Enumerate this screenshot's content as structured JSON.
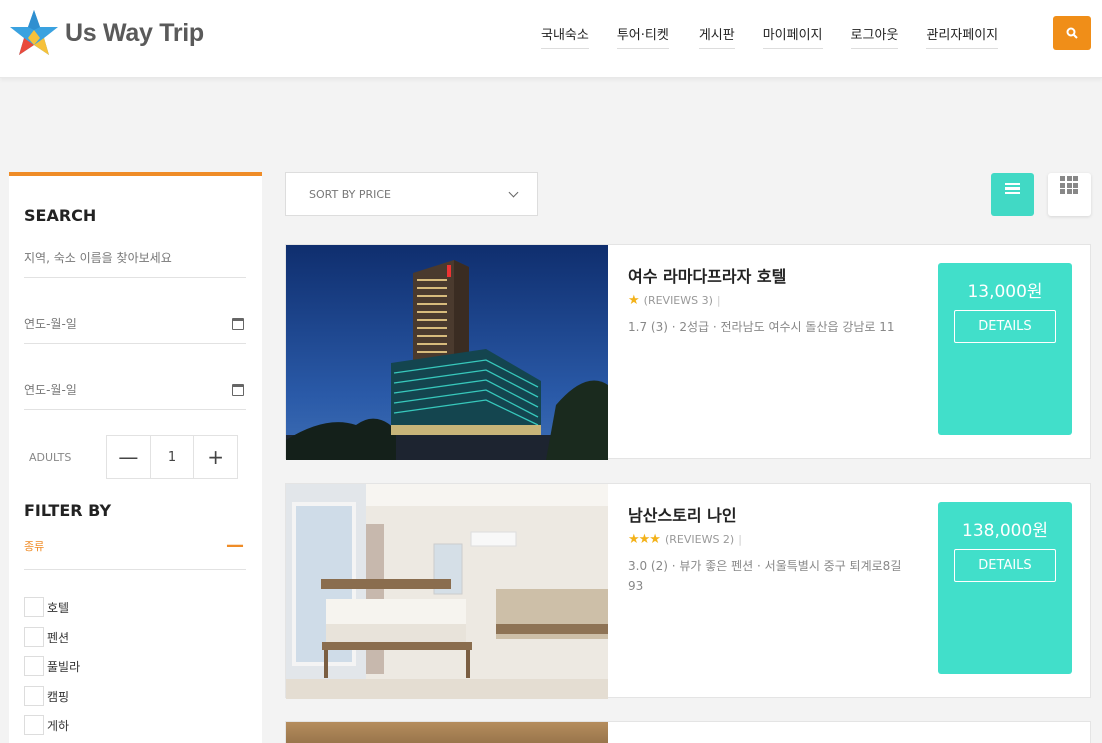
{
  "header": {
    "brand": "Us Way Trip",
    "nav": [
      "국내숙소",
      "투어·티켓",
      "게시판",
      "마이페이지",
      "로그아웃",
      "관리자페이지"
    ],
    "search_icon": "search-icon"
  },
  "sidebar": {
    "search_title": "SEARCH",
    "search_placeholder": "지역, 숙소 이름을 찾아보세요",
    "checkin_placeholder": "연도-월-일",
    "checkout_placeholder": "연도-월-일",
    "adults_label": "ADULTS",
    "adults_value": "1",
    "minus_label": "—",
    "plus_label": "+",
    "filter_title": "FILTER BY",
    "category_label": "종류",
    "category_toggle": "—",
    "types": [
      "호텔",
      "펜션",
      "풀빌라",
      "캠핑",
      "게하"
    ]
  },
  "toolbar": {
    "sort_label": "SORT BY PRICE"
  },
  "results": [
    {
      "name": "여수 라마다프라자 호텔",
      "stars": "★",
      "reviews": "(REVIEWS 3)",
      "info": "1.7 (3) · 2성급 · 전라남도 여수시 돌산읍 강남로 11",
      "price": "13,000원",
      "details": "DETAILS"
    },
    {
      "name": "남산스토리 나인",
      "stars": "★★★",
      "reviews": "(REVIEWS 2)",
      "info": "3.0 (2) · 뷰가 좋은 펜션 · 서울특별시 중구 퇴계로8길 93",
      "price": "138,000원",
      "details": "DETAILS"
    }
  ],
  "colors": {
    "accent": "#ef8c27",
    "teal": "#41dfca"
  }
}
